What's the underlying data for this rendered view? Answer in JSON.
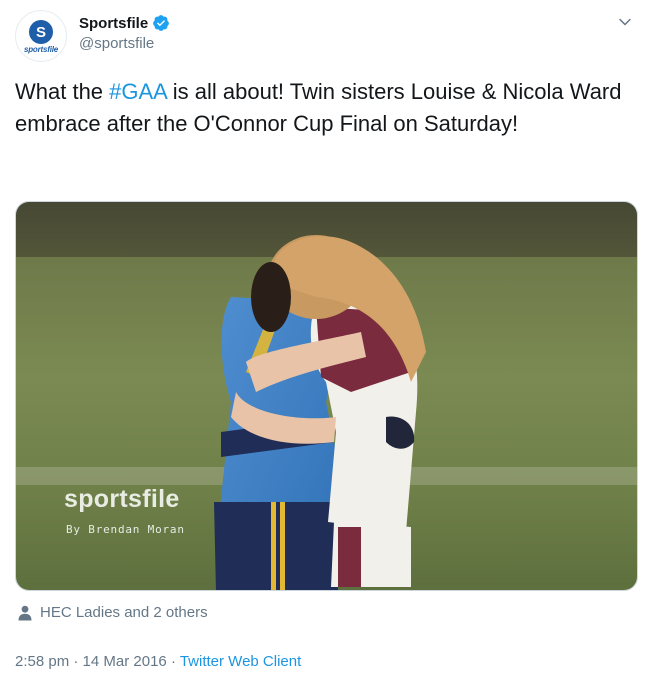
{
  "account": {
    "display_name": "Sportsfile",
    "handle": "@sportsfile",
    "avatar_logo_letter": "S",
    "avatar_logo_word": "sportsfile",
    "verified": true
  },
  "tweet": {
    "text_before": "What the ",
    "hashtag": "#GAA",
    "text_after": " is all about! Twin sisters Louise & Nicola Ward embrace after the O'Connor Cup Final on Saturday!"
  },
  "media": {
    "watermark": "sportsfile",
    "credit": "By Brendan Moran"
  },
  "tagged": {
    "text": "HEC Ladies and 2 others"
  },
  "meta": {
    "time": "2:58 pm",
    "separator": " · ",
    "date": "14 Mar 2016",
    "client": "Twitter Web Client"
  },
  "colors": {
    "link": "#1b95e0",
    "secondary_text": "#657786",
    "primary_text": "#14171a",
    "verified_badge": "#1da1f2"
  },
  "icons": [
    "verified-badge-icon",
    "chevron-down-icon",
    "person-icon"
  ]
}
